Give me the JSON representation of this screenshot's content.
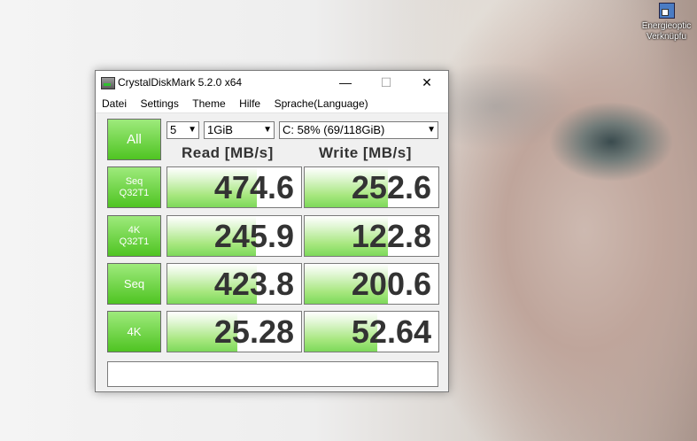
{
  "desktop": {
    "icon_label_line1": "Energieoptic",
    "icon_label_line2": "Verknüpfu"
  },
  "window": {
    "title": "CrystalDiskMark 5.2.0 x64",
    "minimize": "—",
    "maximize": "☐",
    "close": "✕"
  },
  "menu": [
    "Datei",
    "Settings",
    "Theme",
    "Hilfe",
    "Sprache(Language)"
  ],
  "controls": {
    "all_button": "All",
    "count": "5",
    "size": "1GiB",
    "drive": "C: 58% (69/118GiB)"
  },
  "headers": {
    "read": "Read [MB/s]",
    "write": "Write [MB/s]"
  },
  "tests": [
    {
      "line1": "Seq",
      "line2": "Q32T1",
      "read": "474.6",
      "write": "252.6",
      "read_fill": 0.67,
      "write_fill": 0.62
    },
    {
      "line1": "4K",
      "line2": "Q32T1",
      "read": "245.9",
      "write": "122.8",
      "read_fill": 0.66,
      "write_fill": 0.62
    },
    {
      "line1": "Seq",
      "line2": "",
      "read": "423.8",
      "write": "200.6",
      "read_fill": 0.67,
      "write_fill": 0.62
    },
    {
      "line1": "4K",
      "line2": "",
      "read": "25.28",
      "write": "52.64",
      "read_fill": 0.52,
      "write_fill": 0.54
    }
  ],
  "comment": "",
  "colors": {
    "button_green": "#4fc422",
    "bar_green": "#7dd95a",
    "value_text": "#333333"
  }
}
